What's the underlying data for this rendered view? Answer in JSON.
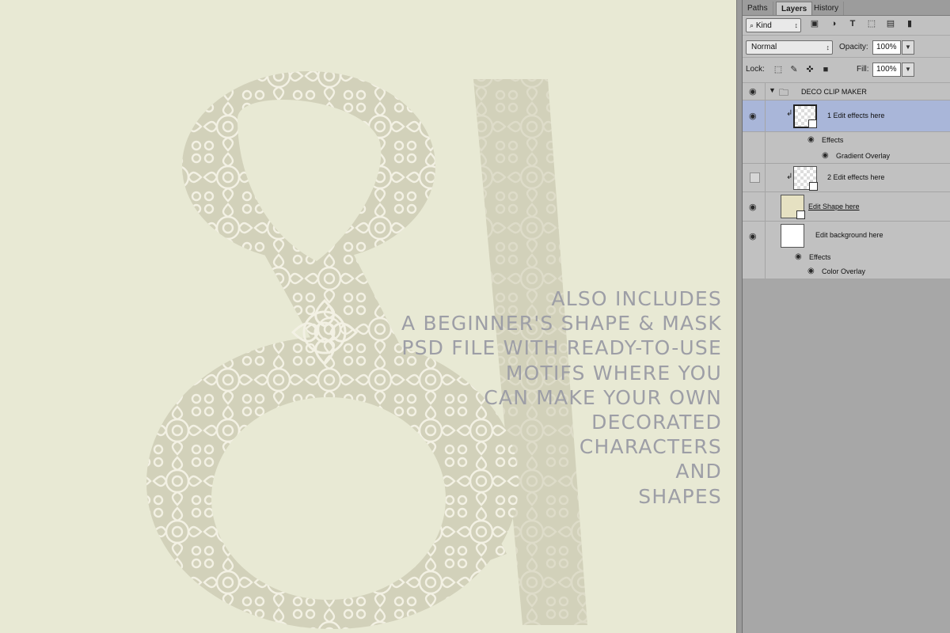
{
  "canvas": {
    "background": "#e8e9d4",
    "glyph_color": "#d2d1ba",
    "pattern_color": "#f3f1e4",
    "promo_lines": [
      "ALSO INCLUDES",
      "A BEGINNER'S SHAPE & MASK",
      "PSD FILE WITH READY-TO-USE",
      "MOTIFS WHERE YOU",
      "CAN MAKE YOUR OWN",
      "DECORATED",
      "CHARACTERS",
      "AND",
      "SHAPES"
    ]
  },
  "panel": {
    "tabs": [
      "Paths",
      "Layers",
      "History"
    ],
    "active_tab": "Layers",
    "filter": {
      "label": "Kind",
      "icon": "search-icon",
      "filter_icons": [
        "image-filter-icon",
        "adjustment-filter-icon",
        "type-filter-icon",
        "shape-filter-icon",
        "smart-object-filter-icon",
        "filter-toggle-icon"
      ]
    },
    "blend_mode": "Normal",
    "opacity_label": "Opacity:",
    "opacity_value": "100%",
    "lock_label": "Lock:",
    "lock_icons": [
      "lock-transparent-icon",
      "lock-image-icon",
      "lock-position-icon",
      "lock-all-icon"
    ],
    "fill_label": "Fill:",
    "fill_value": "100%",
    "layers": {
      "group": {
        "name": "DECO CLIP MAKER"
      },
      "layer1": {
        "name": "1 Edit effects here",
        "effects_label": "Effects",
        "effect": "Gradient Overlay"
      },
      "layer2": {
        "name": "2 Edit effects here"
      },
      "layer3": {
        "name": "Edit Shape here"
      },
      "layer4": {
        "name": "Edit background here",
        "effects_label": "Effects",
        "effect": "Color Overlay"
      }
    },
    "selected_color": "#a9b6d9"
  }
}
